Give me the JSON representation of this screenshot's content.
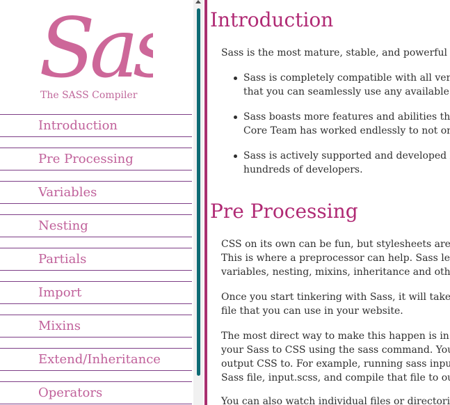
{
  "sidebar": {
    "logo_text": "Sass",
    "tagline": "The SASS Compiler",
    "nav": [
      {
        "label": "Introduction"
      },
      {
        "label": "Pre Processing"
      },
      {
        "label": "Variables"
      },
      {
        "label": "Nesting"
      },
      {
        "label": "Partials"
      },
      {
        "label": "Import"
      },
      {
        "label": "Mixins"
      },
      {
        "label": "Extend/Inheritance"
      },
      {
        "label": "Operators"
      }
    ]
  },
  "main": {
    "sections": [
      {
        "title": "Introduction",
        "intro": "Sass is the most mature, stable, and powerful professional grade CSS extension language in the world.",
        "bullets": [
          [
            "Sass is completely compatible with all versions of CSS. We take this compatibility seriously, so",
            "that you can seamlessly use any available CSS libraries."
          ],
          [
            "Sass boasts more features and abilities than any other CSS extension language out there. The Sass",
            "Core Team has worked endlessly to not only keep up, but stay ahead."
          ],
          [
            "Sass is actively supported and developed by a consortium of several tech companies and",
            "hundreds of developers."
          ]
        ]
      },
      {
        "title": "Pre Processing",
        "paragraphs": [
          [
            "CSS on its own can be fun, but stylesheets are getting larger, more complex, and harder to maintain.",
            "This is where a preprocessor can help. Sass lets you use features that don't exist in CSS yet like",
            "variables, nesting, mixins, inheritance and other nifty goodies that make writing CSS fun again."
          ],
          [
            "Once you start tinkering with Sass, it will take your preprocessed Sass file and save it as a normal CSS",
            "file that you can use in your website."
          ],
          [
            "The most direct way to make this happen is in your terminal. Once Sass is installed, you can compile",
            "your Sass to CSS using the sass command. You'll need to tell Sass which file to build from, and where to",
            "output CSS to. For example, running sass input.scss output.css from your terminal would take a single",
            "Sass file, input.scss, and compile that file to output.css."
          ],
          [
            "You can also watch individual files or directories with the --watch flag."
          ]
        ]
      }
    ]
  }
}
